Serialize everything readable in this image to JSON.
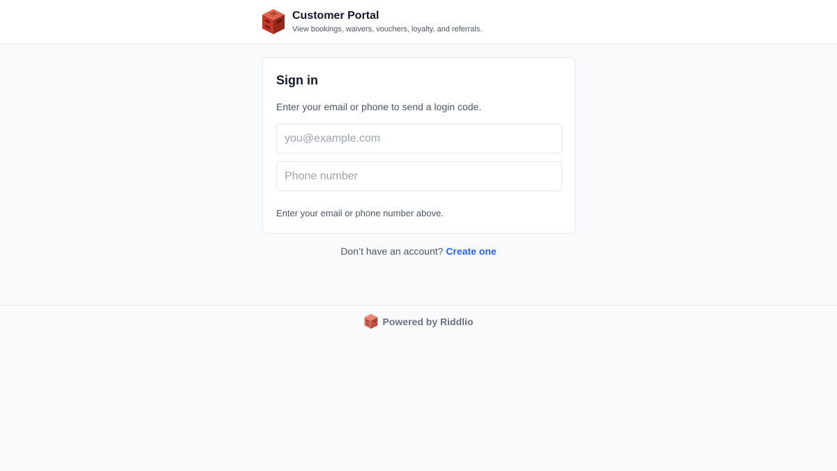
{
  "header": {
    "logo_icon": "riddlio-cube-logo-icon",
    "title": "Customer Portal",
    "subtitle": "View bookings, waivers, vouchers, loyalty, and referrals."
  },
  "signin": {
    "title": "Sign in",
    "description": "Enter your email or phone to send a login code.",
    "email_placeholder": "you@example.com",
    "email_value": "",
    "phone_placeholder": "Phone number",
    "phone_value": "",
    "hint": "Enter your email or phone number above."
  },
  "account": {
    "prompt": "Don’t have an account?",
    "link_label": "Create one"
  },
  "footer": {
    "logo_icon": "riddlio-cube-logo-icon",
    "powered_by": "Powered by Riddlio"
  },
  "colors": {
    "brand": "#c0392b",
    "link": "#2563eb",
    "background": "#f8fafc",
    "border": "#e5e7eb"
  }
}
